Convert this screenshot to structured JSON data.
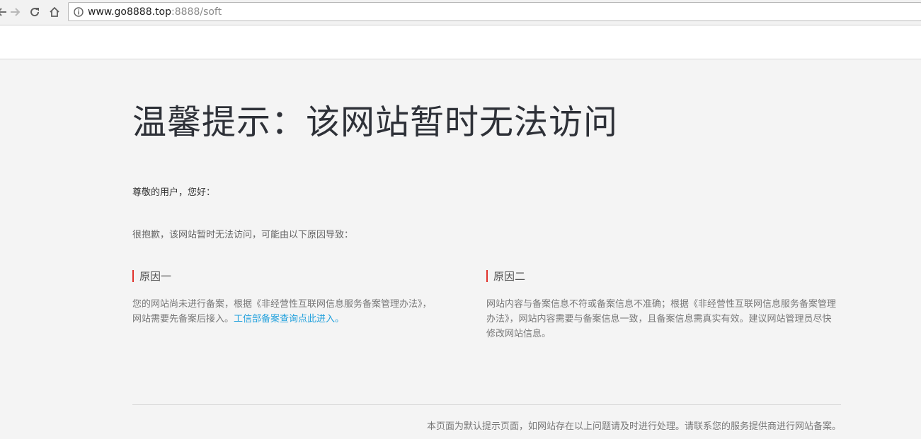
{
  "browser": {
    "url_host": "www.go8888.top",
    "url_rest": ":8888/soft"
  },
  "page": {
    "title": "温馨提示：该网站暂时无法访问",
    "greeting": "尊敬的用户，您好：",
    "apology": "很抱歉，该网站暂时无法访问，可能由以下原因导致：",
    "reasons": [
      {
        "heading": "原因一",
        "text": "您的网站尚未进行备案，根据《非经营性互联网信息服务备案管理办法》，网站需要先备案后接入。",
        "link_text": "工信部备案查询点此进入。"
      },
      {
        "heading": "原因二",
        "text": "网站内容与备案信息不符或备案信息不准确；根据《非经营性互联网信息服务备案管理办法》，网站内容需要与备案信息一致，且备案信息需真实有效。建议网站管理员尽快修改网站信息。"
      }
    ],
    "footer": "本页面为默认提示页面，如网站存在以上问题请及时进行处理。请联系您的服务提供商进行网站备案。"
  },
  "colors": {
    "accent_bar": "#e0322c",
    "link": "#1e9fdc",
    "background": "#f4f4f4"
  },
  "icons": [
    "back-icon",
    "forward-icon",
    "reload-icon",
    "home-icon",
    "info-icon"
  ]
}
